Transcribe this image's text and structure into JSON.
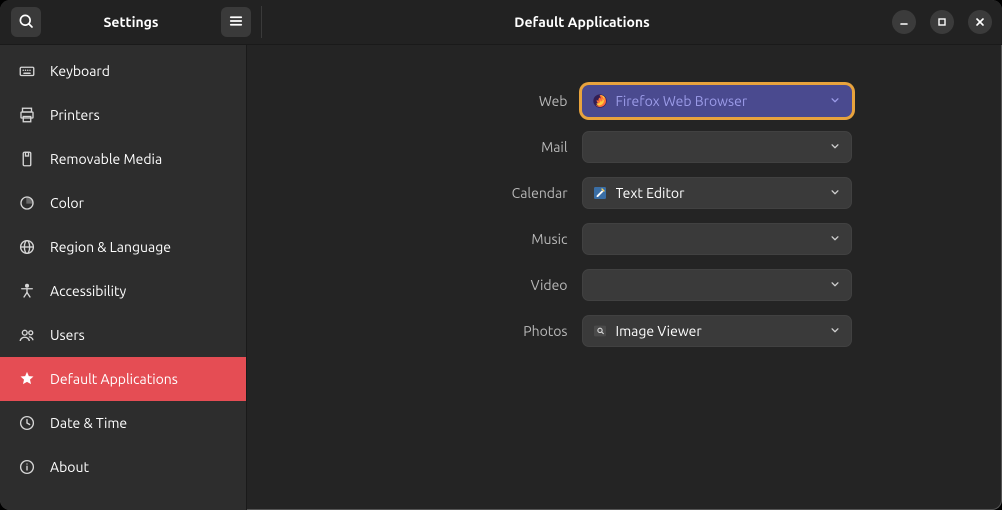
{
  "header": {
    "sidebar_title": "Settings",
    "page_title": "Default Applications"
  },
  "sidebar": {
    "items": [
      {
        "id": "keyboard",
        "label": "Keyboard"
      },
      {
        "id": "printers",
        "label": "Printers"
      },
      {
        "id": "removable-media",
        "label": "Removable Media"
      },
      {
        "id": "color",
        "label": "Color"
      },
      {
        "id": "region-language",
        "label": "Region & Language"
      },
      {
        "id": "accessibility",
        "label": "Accessibility"
      },
      {
        "id": "users",
        "label": "Users"
      },
      {
        "id": "default-applications",
        "label": "Default Applications",
        "active": true
      },
      {
        "id": "date-time",
        "label": "Date & Time"
      },
      {
        "id": "about",
        "label": "About"
      }
    ]
  },
  "defaults": {
    "rows": [
      {
        "key": "web",
        "label": "Web",
        "value": "Firefox Web Browser",
        "app_icon": "firefox",
        "highlighted": true
      },
      {
        "key": "mail",
        "label": "Mail",
        "value": "",
        "app_icon": "",
        "highlighted": false
      },
      {
        "key": "calendar",
        "label": "Calendar",
        "value": "Text Editor",
        "app_icon": "text-editor",
        "highlighted": false
      },
      {
        "key": "music",
        "label": "Music",
        "value": "",
        "app_icon": "",
        "highlighted": false
      },
      {
        "key": "video",
        "label": "Video",
        "value": "",
        "app_icon": "",
        "highlighted": false
      },
      {
        "key": "photos",
        "label": "Photos",
        "value": "Image Viewer",
        "app_icon": "image-viewer",
        "highlighted": false
      }
    ]
  },
  "colors": {
    "accent": "#e54d54",
    "highlight_border": "#e8a33d",
    "highlight_fill": "#4a4a8f"
  }
}
